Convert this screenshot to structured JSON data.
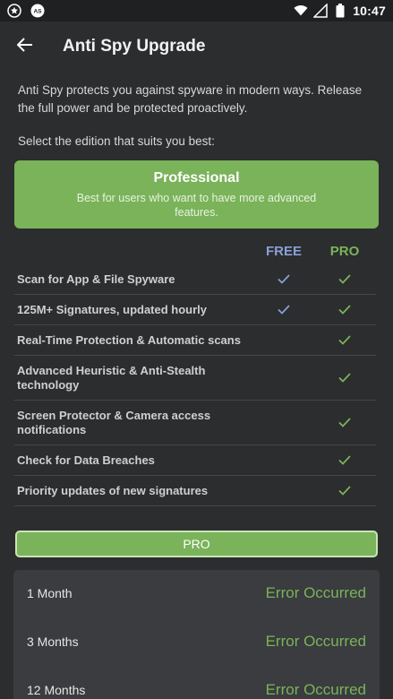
{
  "status_bar": {
    "time": "10:47",
    "icons_left": [
      "star-badge-icon",
      "notification-icon"
    ],
    "icons_right": [
      "wifi-icon",
      "signal-icon",
      "battery-icon"
    ]
  },
  "app_bar": {
    "back_icon": "arrow-left-icon",
    "title": "Anti Spy Upgrade"
  },
  "intro_text": "Anti Spy protects you against spyware in modern ways. Release the full power and be protected proactively.",
  "select_label": "Select the edition that suits you best:",
  "edition": {
    "title": "Professional",
    "description": "Best for users who want to have more advanced features."
  },
  "columns": {
    "free": "FREE",
    "pro": "PRO"
  },
  "features": [
    {
      "label": "Scan for App & File Spyware",
      "free": true,
      "pro": true
    },
    {
      "label": "125M+ Signatures, updated hourly",
      "free": true,
      "pro": true
    },
    {
      "label": "Real-Time Protection & Automatic scans",
      "free": false,
      "pro": true
    },
    {
      "label": "Advanced Heuristic & Anti-Stealth technology",
      "free": false,
      "pro": true
    },
    {
      "label": "Screen Protector & Camera access notifications",
      "free": false,
      "pro": true
    },
    {
      "label": "Check for Data Breaches",
      "free": false,
      "pro": true
    },
    {
      "label": "Priority updates of new signatures",
      "free": false,
      "pro": true
    }
  ],
  "pro_button": "PRO",
  "plans": [
    {
      "name": "1 Month",
      "status": "Error Occurred"
    },
    {
      "name": "3 Months",
      "status": "Error Occurred"
    },
    {
      "name": "12 Months",
      "status": "Error Occurred"
    }
  ],
  "colors": {
    "accent_green": "#7ab35a",
    "free_blue": "#8b9fd6",
    "background": "#2b2d2f"
  }
}
